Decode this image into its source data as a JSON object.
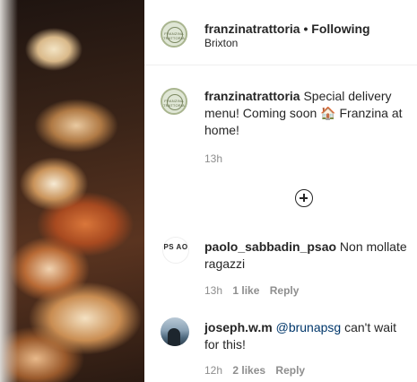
{
  "header": {
    "username": "franzinatrattoria",
    "separator": "•",
    "follow_status": "Following",
    "location": "Brixton",
    "avatar_text": "FRANZINA TRATTORIA"
  },
  "caption": {
    "username": "franzinatrattoria",
    "text": " Special delivery menu! Coming soon 🏠 Franzina at home!",
    "time": "13h"
  },
  "comments": [
    {
      "username": "paolo_sabbadin_psao",
      "avatar_text": "PS AO",
      "text": " Non mollate ragazzi",
      "time": "13h",
      "likes": "1 like",
      "reply": "Reply"
    },
    {
      "username": "joseph.w.m",
      "mention": "@brunapsg",
      "text": " can't wait for this!",
      "time": "12h",
      "likes": "2 likes",
      "reply": "Reply"
    }
  ],
  "icons": {
    "load_more": "plus-circle-icon"
  }
}
